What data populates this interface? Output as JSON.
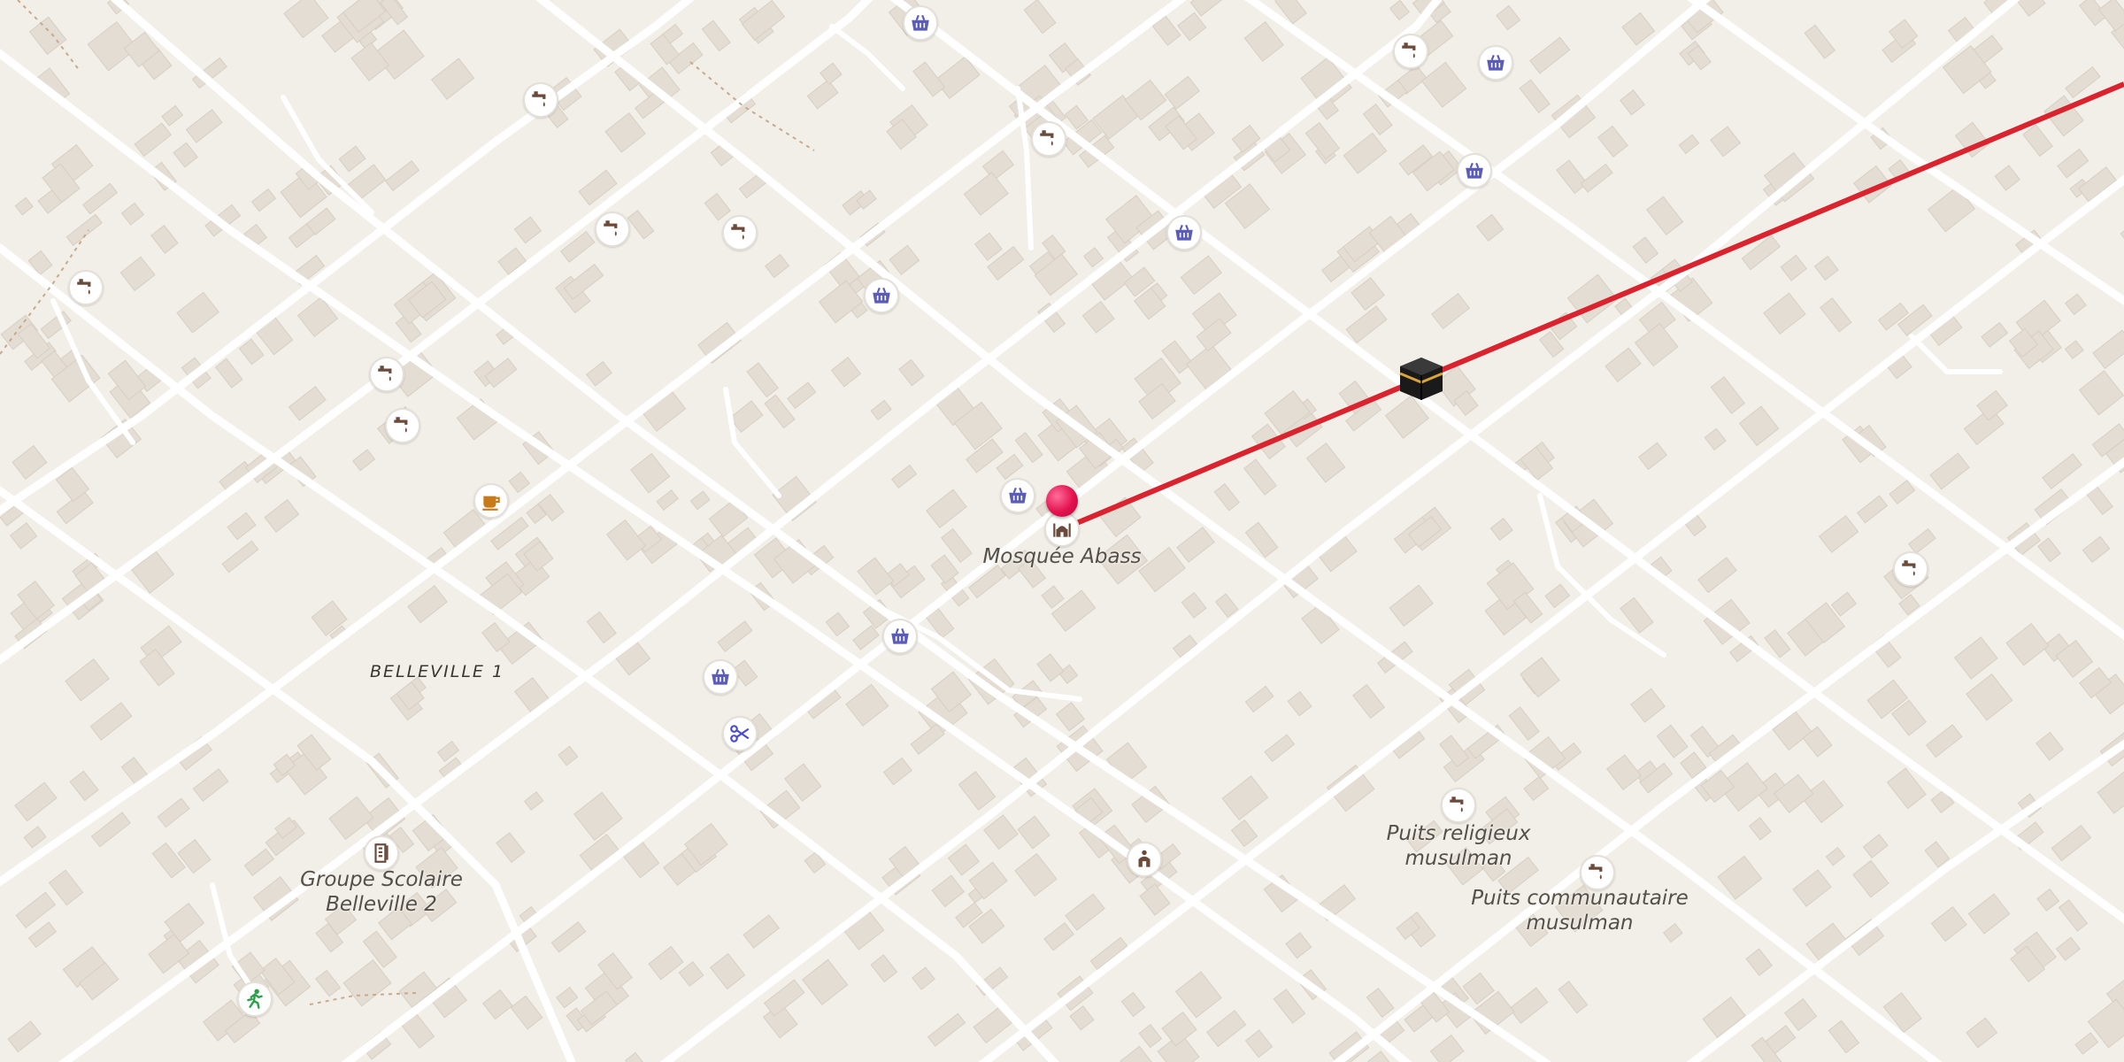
{
  "map": {
    "district_label": "BELLEVILLE 1",
    "places": [
      {
        "id": "mosque",
        "name": "Mosquée Abass",
        "icon": "mosque-icon"
      },
      {
        "id": "school",
        "name_line1": "Groupe Scolaire",
        "name_line2": "Belleville 2",
        "icon": "school-icon"
      },
      {
        "id": "well1",
        "name_line1": "Puits religieux",
        "name_line2": "musulman",
        "icon": "water-tap-icon"
      },
      {
        "id": "well2",
        "name_line1": "Puits communautaire",
        "name_line2": "musulman",
        "icon": "water-tap-icon"
      }
    ],
    "qibla_line_color": "#d9232e",
    "pin_color": "#e3124e",
    "poi_colors": {
      "shop": "#5b5bb8",
      "tap": "#6b4a3a",
      "cafe": "#c77a1a",
      "hairdresser": "#4a4ad0",
      "leisure": "#2e9e4a"
    }
  }
}
